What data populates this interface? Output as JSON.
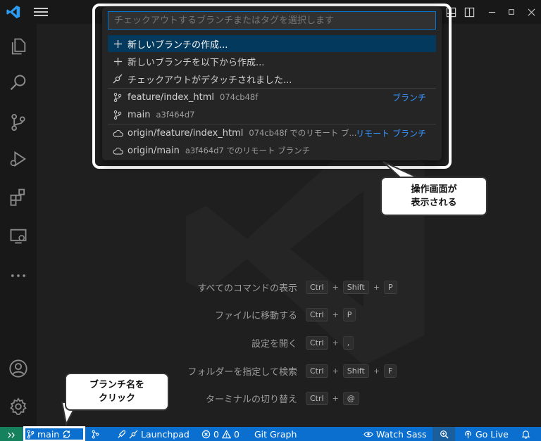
{
  "quick_pick": {
    "placeholder": "チェックアウトするブランチまたはタグを選択します",
    "items": [
      {
        "icon": "plus-icon",
        "label": "新しいブランチの作成...",
        "desc": "",
        "tag": ""
      },
      {
        "icon": "plus-icon",
        "label": "新しいブランチを以下から作成...",
        "desc": "",
        "tag": ""
      },
      {
        "icon": "git-commit-icon",
        "label": "チェックアウトがデタッチされました...",
        "desc": "",
        "tag": ""
      },
      {
        "icon": "git-branch-icon",
        "label": "feature/index_html",
        "desc": "074cb48f",
        "tag": "ブランチ"
      },
      {
        "icon": "git-branch-icon",
        "label": "main",
        "desc": "a3f464d7",
        "tag": ""
      },
      {
        "icon": "cloud-icon",
        "label": "origin/feature/index_html",
        "desc": "074cb48f でのリモート ブ...",
        "tag": "リモート ブランチ"
      },
      {
        "icon": "cloud-icon",
        "label": "origin/main",
        "desc": "a3f464d7 でのリモート ブランチ",
        "tag": ""
      }
    ]
  },
  "shortcuts": [
    {
      "label": "すべてのコマンドの表示",
      "keys": [
        "Ctrl",
        "Shift",
        "P"
      ]
    },
    {
      "label": "ファイルに移動する",
      "keys": [
        "Ctrl",
        "P"
      ]
    },
    {
      "label": "設定を開く",
      "keys": [
        "Ctrl",
        ","
      ]
    },
    {
      "label": "フォルダーを指定して検索",
      "keys": [
        "Ctrl",
        "Shift",
        "F"
      ]
    },
    {
      "label": "ターミナルの切り替え",
      "keys": [
        "Ctrl",
        "@"
      ]
    }
  ],
  "callouts": {
    "top": [
      "操作画面が",
      "表示される"
    ],
    "bottom": [
      "ブランチ名を",
      "クリック"
    ]
  },
  "statusbar": {
    "branch": "main",
    "launchpad": "Launchpad",
    "errors": "0",
    "warnings": "0",
    "git_graph": "Git Graph",
    "watch_sass": "Watch Sass",
    "go_live": "Go Live"
  },
  "colors": {
    "accent": "#0078d4",
    "statusbar": "#0b6fcf",
    "selection": "#04395e",
    "link": "#3794ff"
  }
}
